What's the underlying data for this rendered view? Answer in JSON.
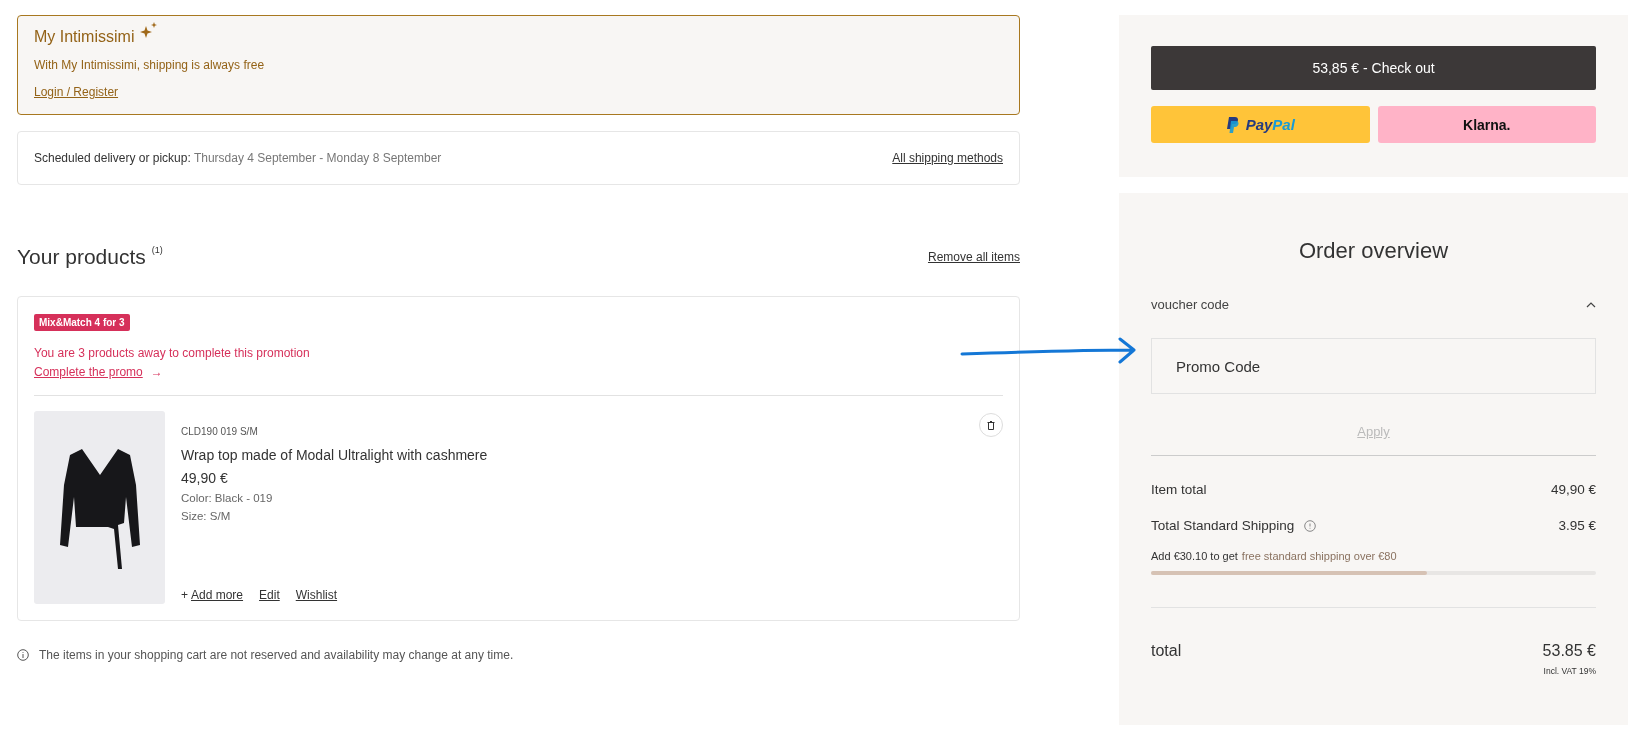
{
  "loyalty": {
    "title": "My Intimissimi",
    "text": "With My Intimissimi, shipping is always free",
    "link": "Login / Register"
  },
  "delivery": {
    "label": "Scheduled delivery or pickup:",
    "dates": "Thursday 4 September - Monday 8 September",
    "link": "All shipping methods"
  },
  "products_header": {
    "title": "Your products",
    "count": "(1)",
    "remove_all": "Remove all items"
  },
  "promotion": {
    "badge": "Mix&Match 4 for 3",
    "message": "You are 3 products away to complete this promotion",
    "link": "Complete the promo",
    "arrow": "→"
  },
  "products": [
    {
      "code": "CLD190 019 S/M",
      "name": "Wrap top made of Modal Ultralight with cashmere",
      "price": "49,90 €",
      "color_text": "Color: Black - 019",
      "size": "Size: S/M",
      "actions": [
        {
          "kind": "add",
          "prefix": "+",
          "label": "Add more"
        },
        {
          "kind": "plain",
          "label": "Edit"
        },
        {
          "kind": "plain",
          "label": "Wishlist"
        }
      ]
    }
  ],
  "notice": "The items in your shopping cart are not reserved and availability may change at any time.",
  "checkout": {
    "button": "53,85 € - Check out",
    "paypal": {
      "pay": "Pay",
      "pal": "Pal"
    },
    "klarna": "Klarna."
  },
  "order_overview": {
    "title": "Order overview",
    "voucher": {
      "label": "voucher code",
      "expanded": true,
      "placeholder": "Promo Code",
      "apply": "Apply",
      "apply_disabled": true
    },
    "lines": [
      {
        "kind": "plain",
        "label": "Item total",
        "value": "49,90 €"
      },
      {
        "kind": "info",
        "label": "Total Standard Shipping",
        "value": "3.95 €"
      }
    ],
    "shipping_note": {
      "lead": "Add €30.10 to get",
      "highlight": "free standard shipping over €80",
      "level": 0.62
    },
    "total": {
      "label": "total",
      "value": "53.85 €",
      "vat": "Incl. VAT 19%"
    }
  }
}
